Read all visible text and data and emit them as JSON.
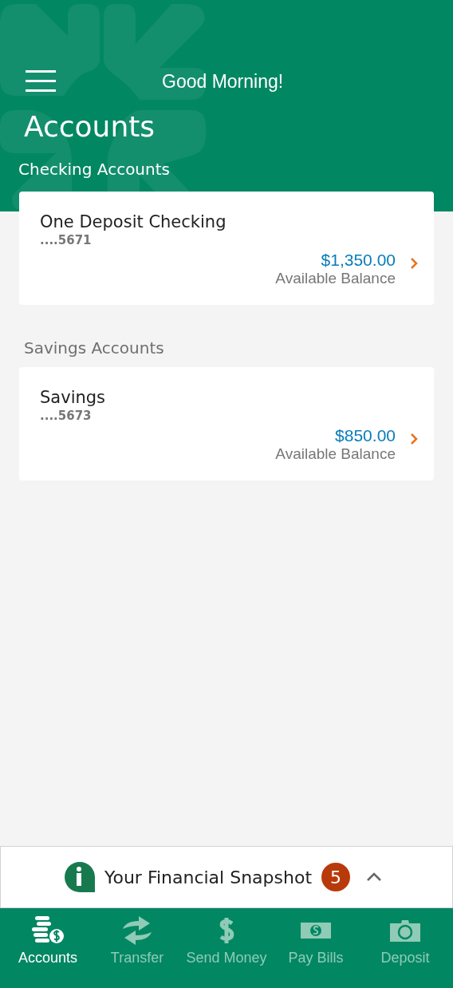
{
  "header": {
    "greeting": "Good Morning!",
    "title": "Accounts"
  },
  "sections": [
    {
      "heading": "Checking Accounts",
      "accounts": [
        {
          "name": "One Deposit Checking",
          "number": "....5671",
          "balance": "$1,350.00",
          "balance_label": "Available Balance"
        }
      ]
    },
    {
      "heading": "Savings Accounts",
      "accounts": [
        {
          "name": "Savings",
          "number": "....5673",
          "balance": "$850.00",
          "balance_label": "Available Balance"
        }
      ]
    }
  ],
  "snapshot": {
    "label": "Your Financial Snapshot",
    "count": "5",
    "expanded": false
  },
  "nav": [
    {
      "kind": "accounts",
      "label": "Accounts",
      "selected": true
    },
    {
      "kind": "transfer",
      "label": "Transfer",
      "selected": false
    },
    {
      "kind": "send",
      "label": "Send Money",
      "selected": false
    },
    {
      "kind": "bills",
      "label": "Pay Bills",
      "selected": false
    },
    {
      "kind": "deposit",
      "label": "Deposit",
      "selected": false
    }
  ]
}
